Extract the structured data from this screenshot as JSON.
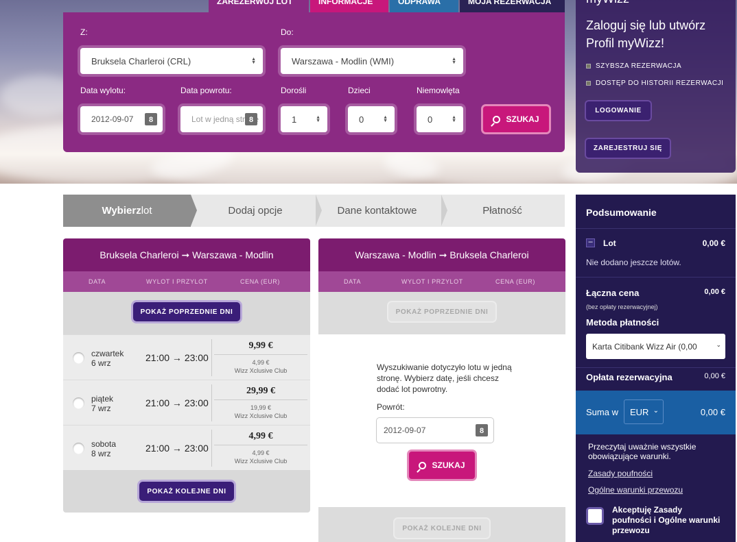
{
  "nav": {
    "tabs": [
      "Zarezerwuj lot",
      "Informacje",
      "Odprawa",
      "Moja rezerwacja"
    ],
    "colors": [
      "#8b2a83",
      "#c8177b",
      "#2a6fa8",
      "#2a2255"
    ]
  },
  "search": {
    "from_label": "Z:",
    "from_value": "Bruksela Charleroi (CRL)",
    "to_label": "Do:",
    "to_value": "Warszawa - Modlin (WMI)",
    "depart_label": "Data wylotu:",
    "depart_value": "2012-09-07",
    "return_label": "Data powrotu:",
    "return_placeholder": "Lot w jedną stronę",
    "adults_label": "Dorośli",
    "adults_value": "1",
    "children_label": "Dzieci",
    "children_value": "0",
    "infants_label": "Niemowlęta",
    "infants_value": "0",
    "calendar_day": "8",
    "search_button": "SZUKAJ"
  },
  "mywizz": {
    "title_partial": "myWizz",
    "heading": "Zaloguj się lub utwórz Profil myWizz!",
    "benefits": [
      "SZYBSZA REZERWACJA",
      "DOSTĘP DO HISTORII REZERWACJI"
    ],
    "login_button": "LOGOWANIE",
    "register_button": "ZAREJESTRUJ SIĘ"
  },
  "steps": {
    "step1_bold": "Wybierz",
    "step1_rest": " lot",
    "step2": "Dodaj opcje",
    "step3": "Dane kontaktowe",
    "step4": "Płatność"
  },
  "outbound": {
    "title": "Bruksela Charleroi ➞ Warszawa - Modlin",
    "col_date": "DATA",
    "col_times": "WYLOT I PRZYLOT",
    "col_price": "CENA (EUR)",
    "prev_button": "POKAŻ POPRZEDNIE DNI",
    "next_button": "POKAŻ KOLEJNE DNI",
    "flights": [
      {
        "day": "czwartek",
        "date": "6 wrz",
        "times": "21:00 → 23:00",
        "price": "9,99 €",
        "club_price": "4,99 €",
        "club": "Wizz Xclusive Club"
      },
      {
        "day": "piątek",
        "date": "7 wrz",
        "times": "21:00 → 23:00",
        "price": "29,99 €",
        "club_price": "19,99 €",
        "club": "Wizz Xclusive Club"
      },
      {
        "day": "sobota",
        "date": "8 wrz",
        "times": "21:00 → 23:00",
        "price": "4,99 €",
        "club_price": "4,99 €",
        "club": "Wizz Xclusive Club"
      }
    ]
  },
  "return": {
    "title": "Warszawa - Modlin ➞ Bruksela Charleroi",
    "col_date": "DATA",
    "col_times": "WYLOT I PRZYLOT",
    "col_price": "CENA (EUR)",
    "prev_button": "POKAŻ POPRZEDNIE DNI",
    "next_button": "POKAŻ KOLEJNE DNI",
    "message": "Wyszukiwanie dotyczyło lotu w jedną stronę. Wybierz datę, jeśli chcesz dodać lot powrotny.",
    "return_label": "Powrót:",
    "return_value": "2012-09-07",
    "calendar_day": "8",
    "search_button": "SZUKAJ"
  },
  "summary": {
    "title": "Podsumowanie",
    "flight_label": "Lot",
    "flight_value": "0,00 €",
    "no_flights": "Nie dodano jeszcze lotów.",
    "total_label": "Łączna cena",
    "total_value": "0,00 €",
    "total_note": "(bez opłaty rezerwacyjnej)",
    "payment_label": "Metoda płatności",
    "payment_value": "Karta Citibank Wizz Air (0,00",
    "fee_label": "Opłata rezerwacyjna",
    "fee_value": "0,00 €",
    "sum_label": "Suma w",
    "currency": "EUR",
    "sum_value": "0,00 €",
    "terms_text": "Przeczytaj uważnie wszystkie obowiązujące warunki.",
    "privacy_link": "Zasady poufności",
    "conditions_link": "Ogólne warunki przewozu",
    "accept_text": "Akceptuję Zasady poufności i Ogólne warunki przewozu"
  }
}
